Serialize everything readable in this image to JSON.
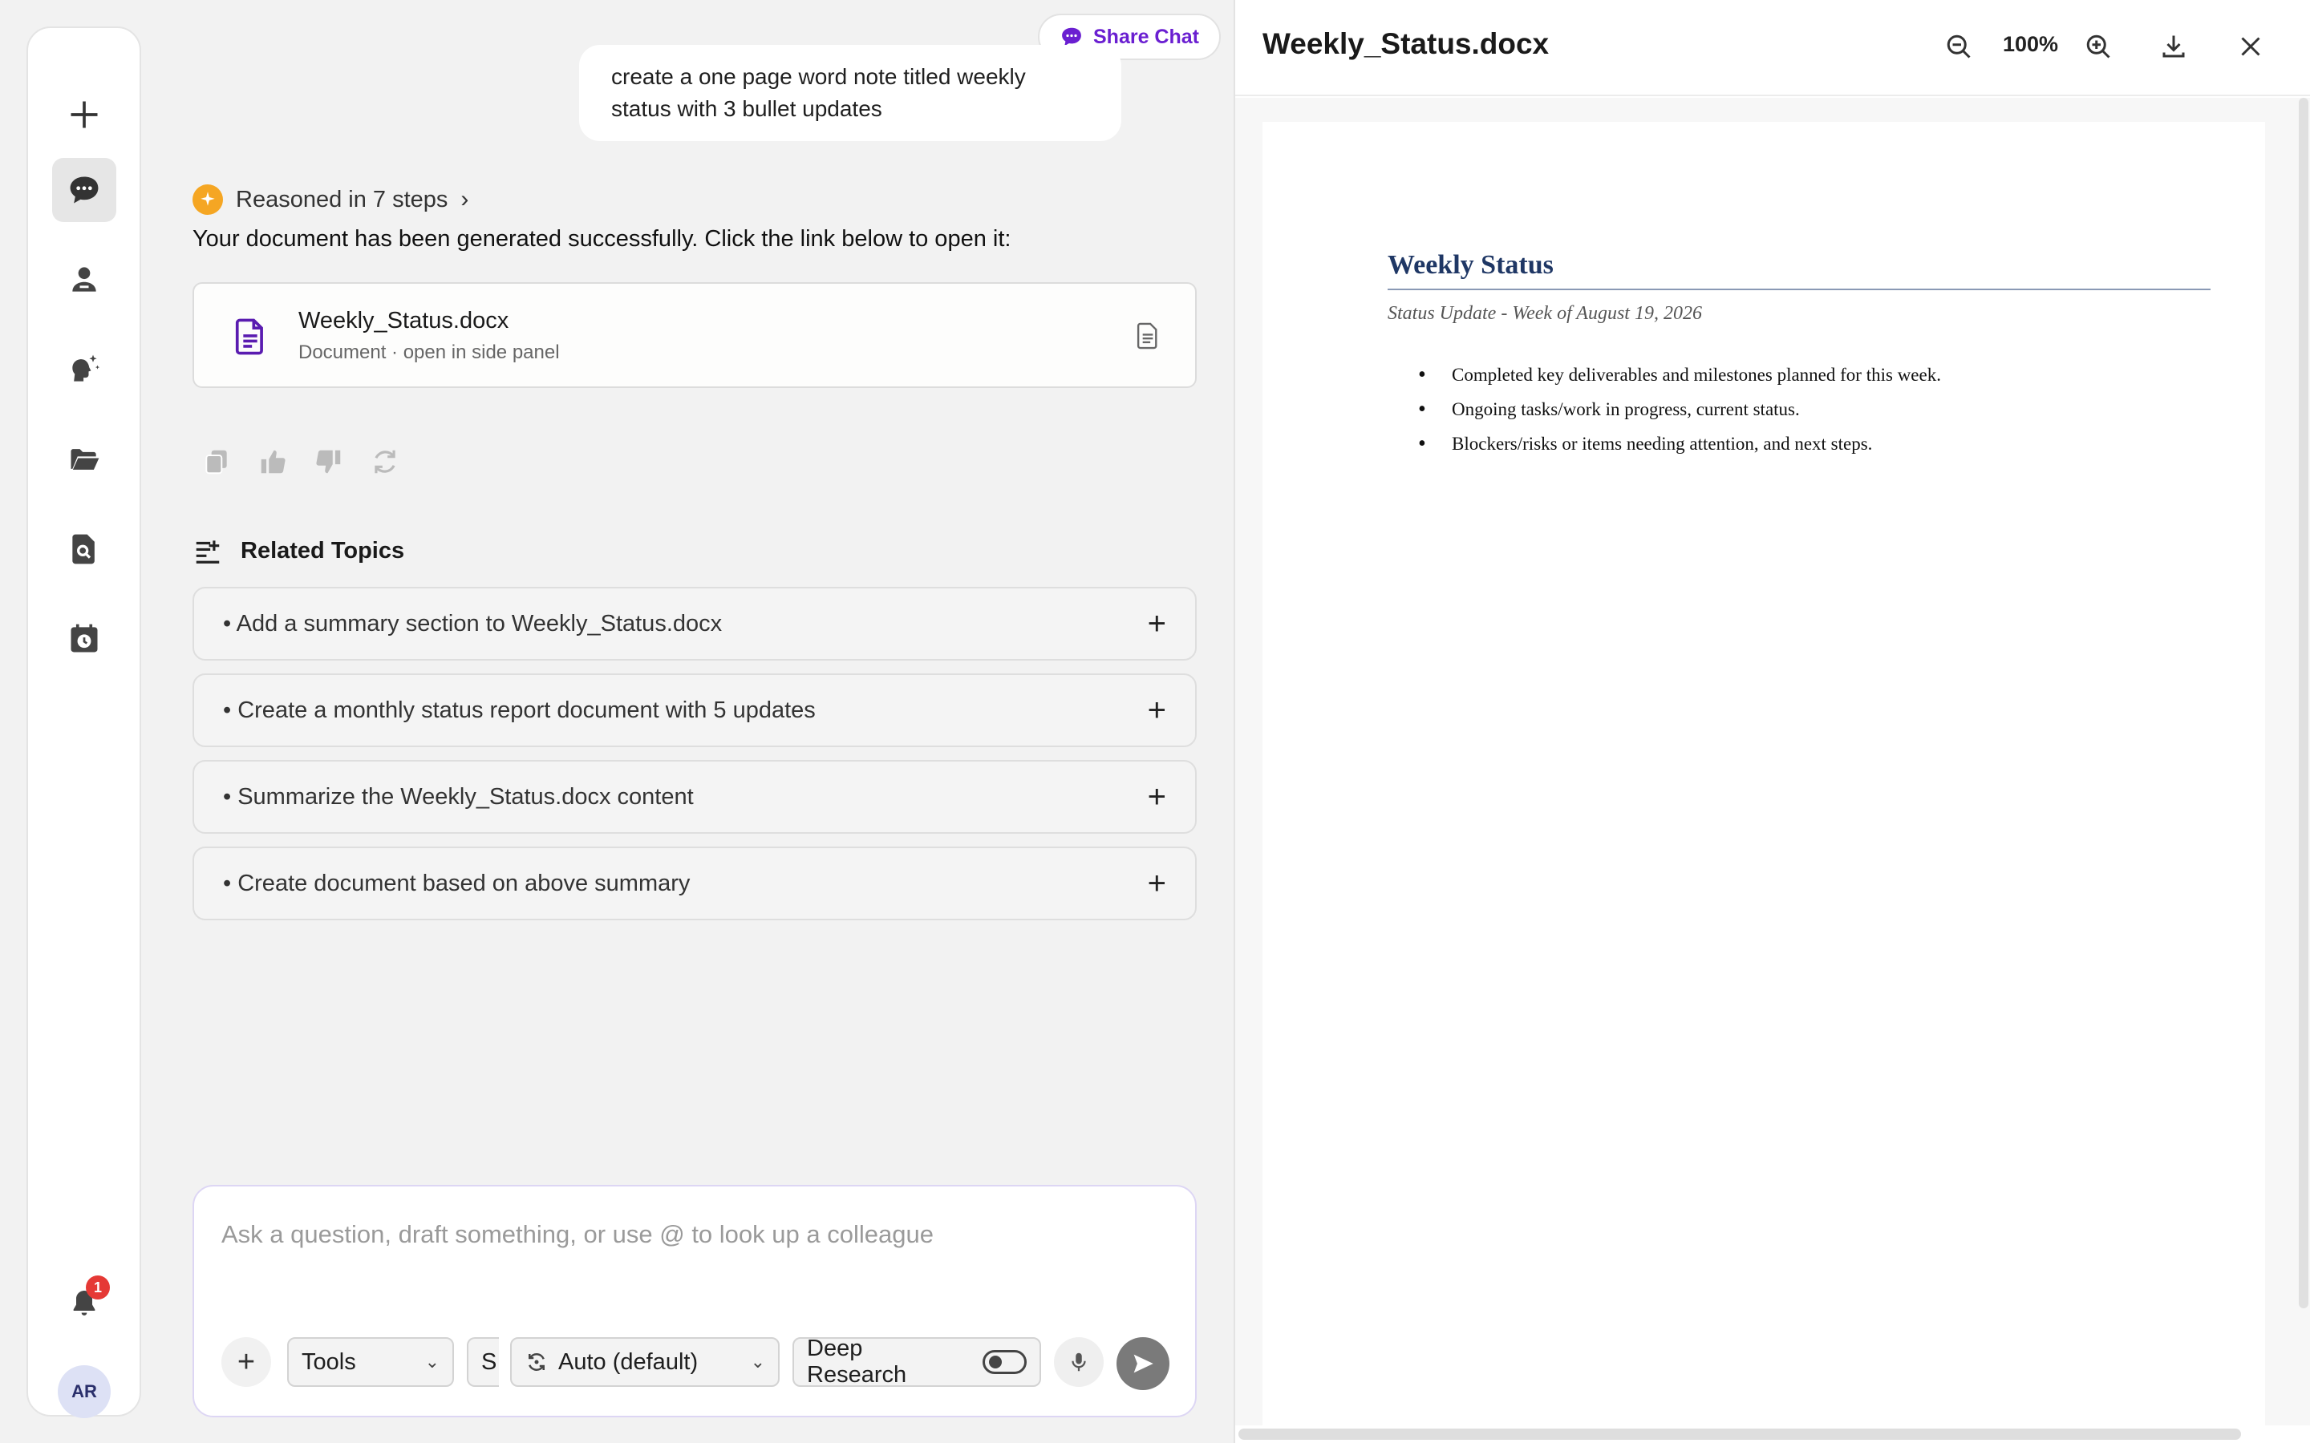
{
  "share_chat": {
    "label": "Share Chat"
  },
  "user_message": "create a one page word note titled weekly status with 3 bullet updates",
  "reasoning": {
    "label": "Reasoned in 7 steps"
  },
  "answer_text": "Your document has been generated successfully. Click the link below to open it:",
  "doc_card": {
    "title": "Weekly_Status.docx",
    "subtitle": "Document · open in side panel"
  },
  "related": {
    "title": "Related Topics",
    "items": [
      "• Add a summary section to Weekly_Status.docx",
      "• Create a monthly status report document with 5 updates",
      "• Summarize the Weekly_Status.docx content",
      "• Create document based on above summary"
    ]
  },
  "composer": {
    "placeholder": "Ask a question, draft something, or use @ to look up a colleague",
    "tools_label": "Tools",
    "truncated_label": "S",
    "model_label": "Auto (default)",
    "deep_research_label": "Deep Research"
  },
  "notifications": {
    "count": "1"
  },
  "user": {
    "initials": "AR"
  },
  "panel": {
    "title": "Weekly_Status.docx",
    "zoom": "100%",
    "document": {
      "heading": "Weekly Status",
      "subtitle": "Status Update - Week of August 19, 2026",
      "bullets": [
        "Completed key deliverables and milestones planned for this week.",
        "Ongoing tasks/work in progress, current status.",
        "Blockers/risks or items needing attention, and next steps."
      ]
    }
  },
  "colors": {
    "accent": "#6a1fd1",
    "heading_blue": "#1f3765",
    "badge_red": "#e53935",
    "spark_orange": "#f5a623"
  }
}
